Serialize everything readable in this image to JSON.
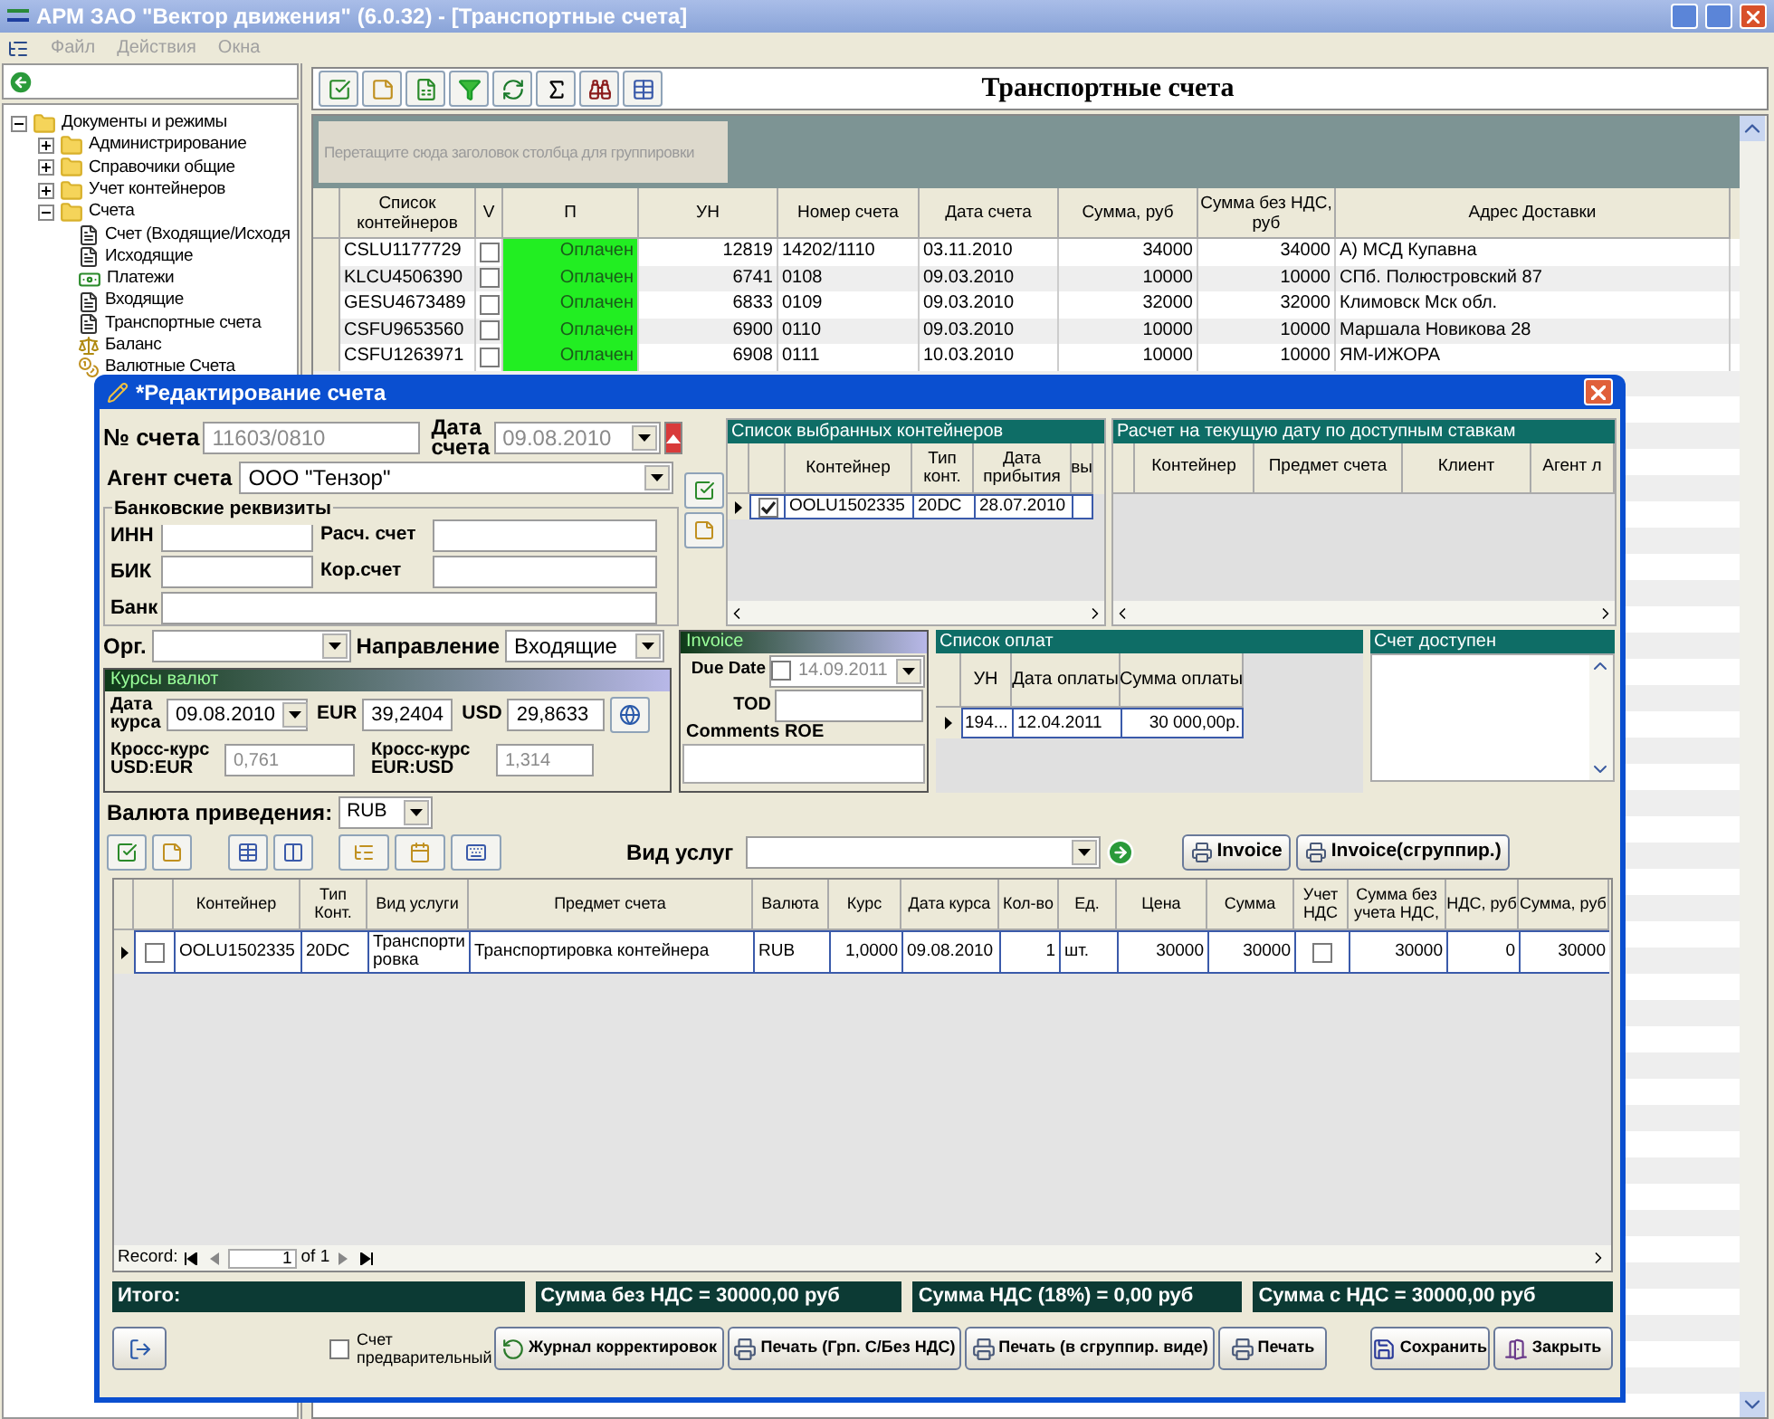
{
  "app": {
    "title": "АРМ ЗАО \"Вектор движения\" (6.0.32) - [Транспортные счета]",
    "menu": [
      "Файл",
      "Действия",
      "Окна"
    ]
  },
  "tree": [
    {
      "label": "Документы и режимы",
      "kind": "folder",
      "expanded": true,
      "children": [
        {
          "label": "Администрирование",
          "kind": "folder",
          "expanded": false
        },
        {
          "label": "Справочики общие",
          "kind": "folder",
          "expanded": false
        },
        {
          "label": "Учет контейнеров",
          "kind": "folder",
          "expanded": false
        },
        {
          "label": "Счета",
          "kind": "folder",
          "expanded": true,
          "children": [
            {
              "label": "Счет (Входящие/Исходя",
              "kind": "document"
            },
            {
              "label": "Исходящие",
              "kind": "document"
            },
            {
              "label": "Платежи",
              "kind": "payments"
            },
            {
              "label": "Входящие",
              "kind": "document"
            },
            {
              "label": "Транспортные счета",
              "kind": "document"
            },
            {
              "label": "Баланс",
              "kind": "balance"
            },
            {
              "label": "Валютные Счета",
              "kind": "currency"
            }
          ]
        }
      ]
    }
  ],
  "page_title": "Транспортные счета",
  "group_hint": "Перетащите сюда заголовок столбца для группировки",
  "invoices_table": {
    "columns": [
      "Список контейнеров",
      "V",
      "П",
      "УН",
      "Номер счета",
      "Дата счета",
      "Сумма, руб",
      "Сумма без НДС, руб",
      "Адрес Доставки"
    ],
    "rows": [
      {
        "containers": "CSLU1177729",
        "checked": false,
        "status": "Оплачен",
        "un": "12819",
        "number": "14202/1110",
        "date": "03.11.2010",
        "sum": "34000",
        "sum_no_vat": "34000",
        "address": "А) МСД Купавна"
      },
      {
        "containers": "KLCU4506390",
        "checked": false,
        "status": "Оплачен",
        "un": "6741",
        "number": "0108",
        "date": "09.03.2010",
        "sum": "10000",
        "sum_no_vat": "10000",
        "address": "СПб. Полюстровский 87"
      },
      {
        "containers": "GESU4673489",
        "checked": false,
        "status": "Оплачен",
        "un": "6833",
        "number": "0109",
        "date": "09.03.2010",
        "sum": "32000",
        "sum_no_vat": "32000",
        "address": "Климовск Мск обл."
      },
      {
        "containers": "CSFU9653560",
        "checked": false,
        "status": "Оплачен",
        "un": "6900",
        "number": "0110",
        "date": "09.03.2010",
        "sum": "10000",
        "sum_no_vat": "10000",
        "address": "Маршала Новикова 28"
      },
      {
        "containers": "CSFU1263971",
        "checked": false,
        "status": "Оплачен",
        "un": "6908",
        "number": "0111",
        "date": "10.03.2010",
        "sum": "10000",
        "sum_no_vat": "10000",
        "address": "ЯМ-ИЖОРА"
      }
    ]
  },
  "dialog": {
    "title": "*Редактирование счета",
    "number_label": "№ счета",
    "number_value": "11603/0810",
    "date_label": "Дата счета",
    "date_value": "09.08.2010",
    "agent_label": "Агент счета",
    "agent_value": "ООО \"Тензор\"",
    "bank": {
      "title": "Банковские реквизиты",
      "inn_label": "ИНН",
      "account_label": "Расч. счет",
      "bik_label": "БИК",
      "corr_label": "Кор.счет",
      "bank_label": "Банк"
    },
    "selected_containers": {
      "title": "Список выбранных контейнеров",
      "columns": [
        "Контейнер",
        "Тип конт.",
        "Дата прибытия",
        "вы"
      ],
      "rows": [
        {
          "checked": true,
          "container": "OOLU1502335",
          "type": "20DC",
          "arrival": "28.07.2010"
        }
      ]
    },
    "rates": {
      "title": "Расчет на текущую дату по доступным ставкам",
      "columns": [
        "Контейнер",
        "Предмет счета",
        "Клиент",
        "Агент л"
      ]
    },
    "org_label": "Орг.",
    "direction_label": "Направление",
    "direction_value": "Входящие",
    "currency": {
      "title": "Курсы валют",
      "date_label": "Дата курса",
      "date_value": "09.08.2010",
      "eur_label": "EUR",
      "eur_value": "39,2404",
      "usd_label": "USD",
      "usd_value": "29,8633",
      "cross1_label": "Кросс-курс USD:EUR",
      "cross1_value": "0,761",
      "cross2_label": "Кросс-курс EUR:USD",
      "cross2_value": "1,314"
    },
    "invoice": {
      "title": "Invoice",
      "due_label": "Due Date",
      "due_checked": false,
      "due_value": "14.09.2011",
      "tod_label": "TOD",
      "comments_label": "Comments ROE"
    },
    "payments": {
      "title": "Список оплат",
      "columns": [
        "УН",
        "Дата оплаты",
        "Сумма оплаты"
      ],
      "rows": [
        {
          "un": "194...",
          "date": "12.04.2011",
          "amount": "30 000,00р."
        }
      ]
    },
    "available": {
      "title": "Счет доступен"
    },
    "target_label": "Валюта приведения:",
    "target_value": "RUB",
    "service_label": "Вид услуг",
    "invoice_buttons": [
      "Invoice",
      "Invoice(сгруппир.)"
    ],
    "services": {
      "columns": [
        "Контейнер",
        "Тип Конт.",
        "Вид услуги",
        "Предмет счета",
        "Валюта",
        "Курс",
        "Дата курса",
        "Кол-во",
        "Ед.",
        "Цена",
        "Сумма",
        "Учет НДС",
        "Сумма без учета НДС,",
        "НДС, руб",
        "Сумма, руб"
      ],
      "rows": [
        {
          "checked": false,
          "container": "OOLU1502335",
          "type": "20DC",
          "service": "Транспортировка",
          "subject": "Транспортировка контейнера",
          "currency": "RUB",
          "rate": "1,0000",
          "rate_date": "09.08.2010",
          "qty": "1",
          "unit": "шт.",
          "price": "30000",
          "sum": "30000",
          "vat_checked": false,
          "sum_no_vat": "30000",
          "vat": "0",
          "total": "30000"
        }
      ]
    },
    "navigator": {
      "label": "Record:",
      "page": "1",
      "of": "of 1"
    },
    "totals": {
      "label": "Итого:",
      "items": [
        "Сумма без НДС = 30000,00 руб",
        "Сумма НДС (18%) = 0,00 руб",
        "Сумма с НДС = 30000,00 руб"
      ]
    },
    "preliminary": {
      "label": "Счет предварительный",
      "checked": false
    },
    "buttons": [
      {
        "label": "Журнал корректировок",
        "kind": "journal"
      },
      {
        "label": "Печать (Грп. С/Без НДС)",
        "kind": "print"
      },
      {
        "label": "Печать (в сгруппир. виде)",
        "kind": "print"
      },
      {
        "label": "Печать",
        "kind": "print"
      },
      {
        "label": "Сохранить",
        "kind": "save"
      },
      {
        "label": "Закрыть",
        "kind": "close"
      }
    ]
  }
}
